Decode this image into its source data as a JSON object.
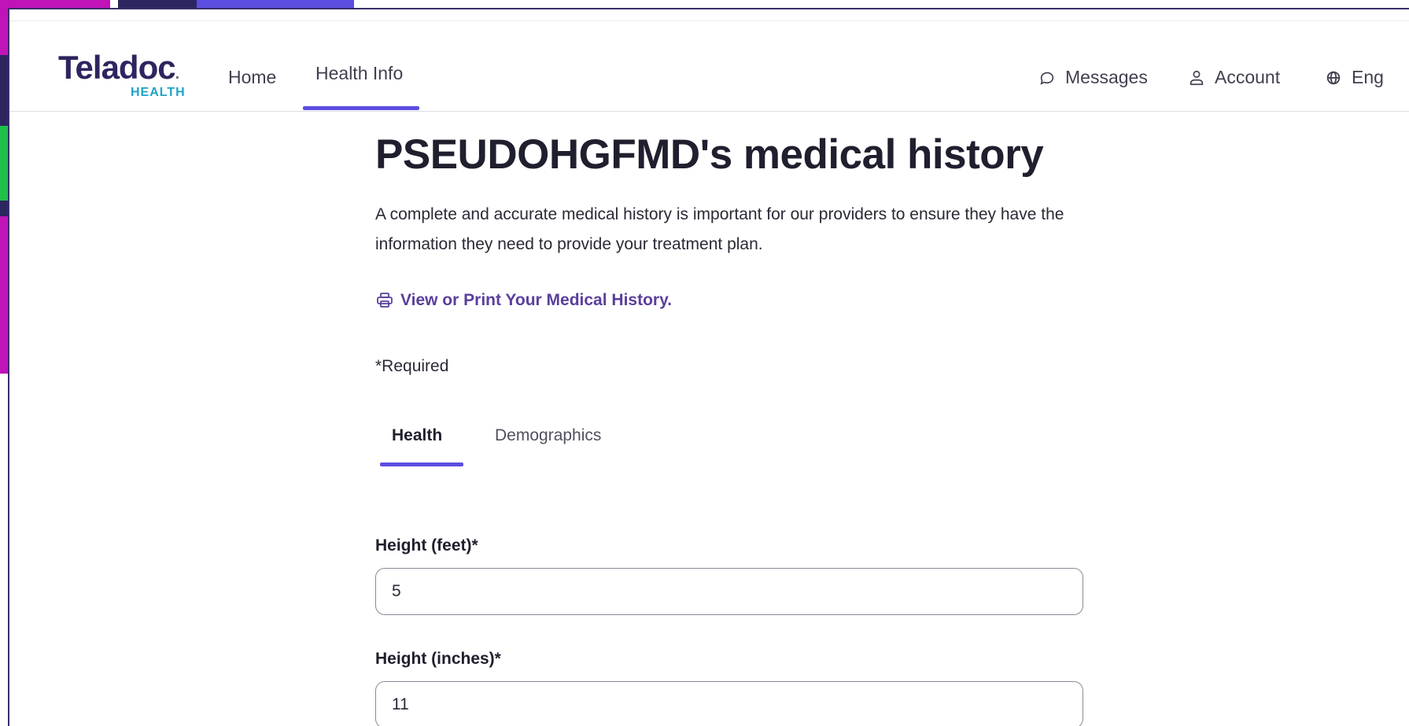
{
  "brand": {
    "logo_text": "Teladoc",
    "logo_dot": ".",
    "logo_sub": "HEALTH",
    "colors": {
      "navy": "#2d2560",
      "teal": "#1fa3c6",
      "accent": "#5b4ee0",
      "link": "#5a3f9c"
    }
  },
  "nav": {
    "home": "Home",
    "health_info": "Health Info",
    "active": "Health Info"
  },
  "top_right": {
    "messages": "Messages",
    "messages_icon": "speech-bubble-icon",
    "account": "Account",
    "account_icon": "person-icon",
    "language": "Eng",
    "language_icon": "globe-icon"
  },
  "page": {
    "title": "PSEUDOHGFMD's medical history",
    "intro": "A complete and accurate medical history is important for our providers to ensure they have the information they need to provide your treatment plan.",
    "print_link": "View or Print Your Medical History.",
    "print_icon": "printer-icon",
    "required_note": "*Required"
  },
  "tabs": [
    {
      "label": "Health",
      "active": true
    },
    {
      "label": "Demographics",
      "active": false
    }
  ],
  "fields": {
    "height_feet": {
      "label": "Height (feet)*",
      "value": "5"
    },
    "height_inches": {
      "label": "Height (inches)*",
      "value": "11"
    }
  }
}
